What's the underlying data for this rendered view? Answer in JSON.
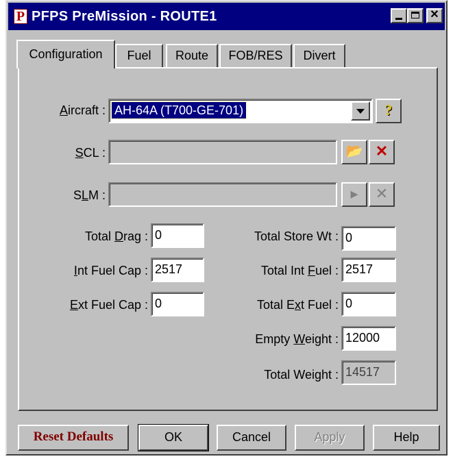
{
  "window": {
    "title": "PFPS PreMission - ROUTE1",
    "icon_letter": "P",
    "min_glyph": "",
    "max_glyph": "",
    "close_glyph": "✕"
  },
  "tabs": [
    {
      "label": "Configuration",
      "active": true
    },
    {
      "label": "Fuel"
    },
    {
      "label": "Route"
    },
    {
      "label": "FOB/RES"
    },
    {
      "label": "Divert"
    }
  ],
  "config": {
    "aircraft": {
      "label_pre": "",
      "label_hot": "A",
      "label_post": "ircraft :",
      "value": "AH-64A (T700-GE-701)",
      "help_glyph": "?"
    },
    "scl": {
      "label_pre": "",
      "label_hot": "S",
      "label_post": "CL :",
      "value": "",
      "open_glyph": "📂",
      "delete_glyph": "✕"
    },
    "slm": {
      "label_pre": "S",
      "label_hot": "L",
      "label_post": "M :",
      "value": "",
      "open_glyph": "▸",
      "delete_glyph": "✕"
    },
    "total_drag": {
      "label_pre": "Total ",
      "label_hot": "D",
      "label_post": "rag :",
      "value": "0"
    },
    "int_fuel_cap": {
      "label_pre": "",
      "label_hot": "I",
      "label_post": "nt Fuel Cap :",
      "value": "2517"
    },
    "ext_fuel_cap": {
      "label_pre": "",
      "label_hot": "E",
      "label_post": "xt Fuel Cap :",
      "value": "0"
    },
    "total_store_wt": {
      "label": "Total Store Wt :",
      "value": "0"
    },
    "total_int_fuel": {
      "label_pre": "Total Int ",
      "label_hot": "F",
      "label_post": "uel :",
      "value": "2517"
    },
    "total_ext_fuel": {
      "label_pre": "Total E",
      "label_hot": "x",
      "label_post": "t Fuel :",
      "value": "0"
    },
    "empty_weight": {
      "label_pre": "Empty ",
      "label_hot": "W",
      "label_post": "eight :",
      "value": "12000"
    },
    "total_weight": {
      "label": "Total Weight :",
      "value": "14517"
    }
  },
  "buttons": {
    "reset": "Reset Defaults",
    "ok": "OK",
    "cancel": "Cancel",
    "apply": "Apply",
    "help": "Help"
  },
  "colors": {
    "titlebar": "#000080",
    "face": "#c0c0c0",
    "selection": "#000080",
    "reset_text": "#800000",
    "delete_icon": "#c00000",
    "help_icon": "#e0c000"
  }
}
